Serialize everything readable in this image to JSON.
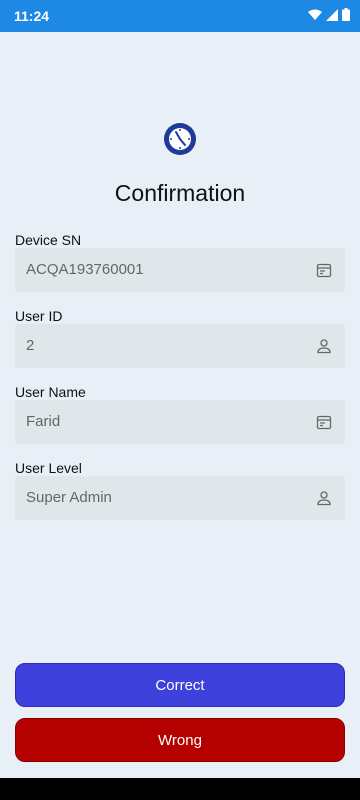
{
  "status_bar": {
    "time": "11:24",
    "icons": [
      "wifi-icon",
      "cellular-signal-icon",
      "battery-icon"
    ]
  },
  "page": {
    "logo_icon": "clock-icon",
    "title": "Confirmation"
  },
  "fields": [
    {
      "label": "Device SN",
      "value": "ACQA193760001",
      "icon": "calendar-icon"
    },
    {
      "label": "User ID",
      "value": "2",
      "icon": "person-icon"
    },
    {
      "label": "User Name",
      "value": "Farid",
      "icon": "calendar-icon"
    },
    {
      "label": "User Level",
      "value": "Super Admin",
      "icon": "person-icon"
    }
  ],
  "buttons": {
    "correct_label": "Correct",
    "wrong_label": "Wrong"
  },
  "colors": {
    "status_bar": "#1e88e5",
    "background": "#e8eff7",
    "field_bg": "#dfe7ea",
    "correct": "#3f41dd",
    "wrong": "#b50000"
  }
}
